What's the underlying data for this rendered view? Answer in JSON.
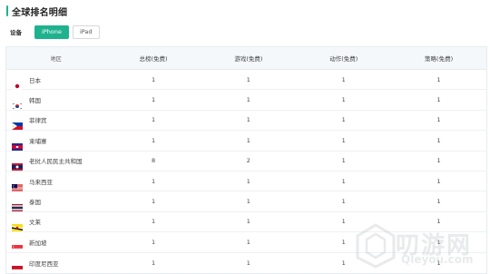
{
  "header": {
    "title": "全球排名明细"
  },
  "device": {
    "label": "设备",
    "options": [
      "iPhone",
      "iPad"
    ],
    "selected": "iPhone"
  },
  "table": {
    "columns": [
      "地区",
      "总榜(免费)",
      "游戏(免费)",
      "动作(免费)",
      "策略(免费)"
    ],
    "rows": [
      {
        "region": "日本",
        "flag": "jp-flag-icon",
        "values": [
          "1",
          "1",
          "1",
          "1"
        ]
      },
      {
        "region": "韩国",
        "flag": "kr-flag-icon",
        "values": [
          "1",
          "1",
          "1",
          "1"
        ]
      },
      {
        "region": "菲律宾",
        "flag": "ph-flag-icon",
        "values": [
          "1",
          "1",
          "1",
          "1"
        ]
      },
      {
        "region": "柬埔寨",
        "flag": "kh-flag-icon",
        "values": [
          "1",
          "1",
          "1",
          "1"
        ]
      },
      {
        "region": "老挝人民民主共和国",
        "flag": "la-flag-icon",
        "values": [
          "8",
          "2",
          "1",
          "1"
        ]
      },
      {
        "region": "马来西亚",
        "flag": "my-flag-icon",
        "values": [
          "1",
          "1",
          "1",
          "1"
        ]
      },
      {
        "region": "泰国",
        "flag": "th-flag-icon",
        "values": [
          "1",
          "1",
          "1",
          "1"
        ]
      },
      {
        "region": "文莱",
        "flag": "bn-flag-icon",
        "values": [
          "1",
          "1",
          "1",
          "1"
        ]
      },
      {
        "region": "新加坡",
        "flag": "sg-flag-icon",
        "values": [
          "1",
          "1",
          "1",
          "1"
        ]
      },
      {
        "region": "印度尼西亚",
        "flag": "id-flag-icon",
        "values": [
          "1",
          "1",
          "1",
          "1"
        ]
      }
    ]
  },
  "watermark": {
    "text": "叨游网",
    "url": "Qleyou.com"
  },
  "colors": {
    "accent": "#1fb28f",
    "header_bg": "#f5f8fb",
    "border": "#e6ecf2"
  }
}
